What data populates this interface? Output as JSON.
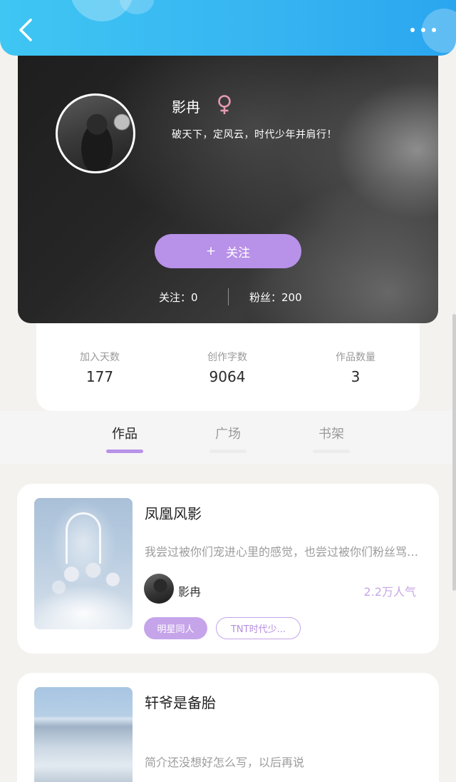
{
  "profile": {
    "username": "影冉",
    "gender_icon": "female-icon",
    "bio": "破天下，定风云，时代少年并肩行！",
    "follow_label": "关注",
    "following": "关注：0",
    "fans": "粉丝：200"
  },
  "stats": [
    {
      "label": "加入天数",
      "value": "177"
    },
    {
      "label": "创作字数",
      "value": "9064"
    },
    {
      "label": "作品数量",
      "value": "3"
    }
  ],
  "tabs": [
    {
      "label": "作品",
      "active": true
    },
    {
      "label": "广场",
      "active": false
    },
    {
      "label": "书架",
      "active": false
    }
  ],
  "books": [
    {
      "title": "凤凰风影",
      "desc": "我尝过被你们宠进心里的感觉，也尝过被你们粉丝骂的滋味",
      "author": "影冉",
      "popularity": "2.2万人气",
      "tags": [
        "明星同人",
        "TNT时代少..."
      ]
    },
    {
      "title": "轩爷是备胎",
      "desc": "简介还没想好怎么写，以后再说"
    }
  ],
  "colors": {
    "topbar": "#36b4f1",
    "accent": "#b891e8",
    "popularity": "#c7a6e6"
  }
}
